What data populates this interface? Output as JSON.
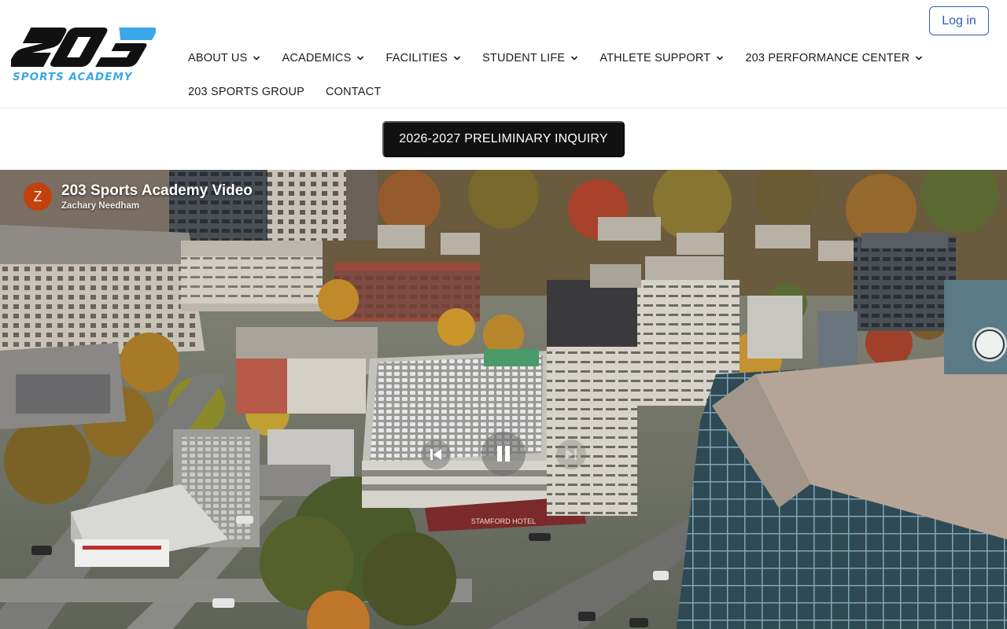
{
  "brand": {
    "logo_text": "203",
    "tagline": "SPORTS ACADEMY",
    "colors": {
      "logo_black": "#111111",
      "logo_blue": "#3aa8e8"
    }
  },
  "header": {
    "login_label": "Log in",
    "nav_primary": [
      {
        "label": "ABOUT US",
        "has_dropdown": true
      },
      {
        "label": "ACADEMICS",
        "has_dropdown": true
      },
      {
        "label": "FACILITIES",
        "has_dropdown": true
      },
      {
        "label": "STUDENT LIFE",
        "has_dropdown": true
      },
      {
        "label": "ATHLETE SUPPORT",
        "has_dropdown": true
      },
      {
        "label": "203 PERFORMANCE CENTER",
        "has_dropdown": true
      }
    ],
    "nav_secondary": [
      {
        "label": "203 SPORTS GROUP",
        "has_dropdown": false
      },
      {
        "label": "CONTACT",
        "has_dropdown": false
      }
    ]
  },
  "cta": {
    "inquiry_label": "2026-2027 PRELIMINARY INQUIRY"
  },
  "video": {
    "title": "203 Sports Academy Video",
    "author": "Zachary Needham",
    "avatar_letter": "Z",
    "avatar_color": "#c2410c",
    "sign_text": "STAMFORD HOTEL",
    "controls": [
      "previous-icon",
      "pause-icon",
      "next-icon"
    ]
  }
}
